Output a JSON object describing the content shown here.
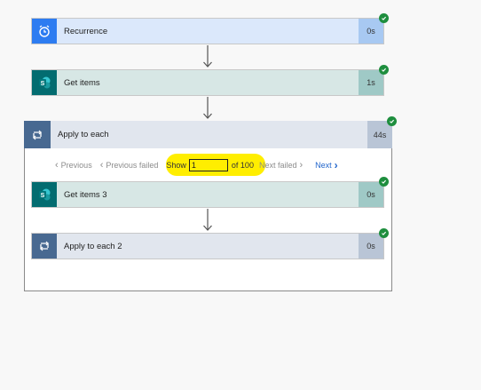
{
  "flow": {
    "steps": [
      {
        "label": "Recurrence",
        "duration": "0s",
        "icon": "alarm-clock-icon"
      },
      {
        "label": "Get items",
        "duration": "1s",
        "icon": "sharepoint-icon"
      }
    ],
    "apply_to_each": {
      "label": "Apply to each",
      "duration": "44s",
      "icon": "loop-icon",
      "pager": {
        "previous": "Previous",
        "previous_failed": "Previous failed",
        "show_label": "Show",
        "current_value": "1",
        "of_label": "of 100",
        "next_failed": "Next failed",
        "next": "Next"
      },
      "inner_steps": [
        {
          "label": "Get items 3",
          "duration": "0s",
          "icon": "sharepoint-icon"
        },
        {
          "label": "Apply to each 2",
          "duration": "0s",
          "icon": "loop-icon"
        }
      ]
    }
  },
  "colors": {
    "recurrence_bg": "#dbe8fb",
    "recurrence_icon": "#2d7cf1",
    "recurrence_dur": "#a8c9f2",
    "sharepoint_bg": "#d7e7e5",
    "sharepoint_icon": "#036c70",
    "sharepoint_dur": "#9fc9c6",
    "loop_bg": "#e1e6ee",
    "loop_icon": "#486991",
    "loop_dur": "#b9c5d6",
    "success": "#1e8e3e",
    "highlight": "#ffee00",
    "next_link": "#2266cc"
  }
}
